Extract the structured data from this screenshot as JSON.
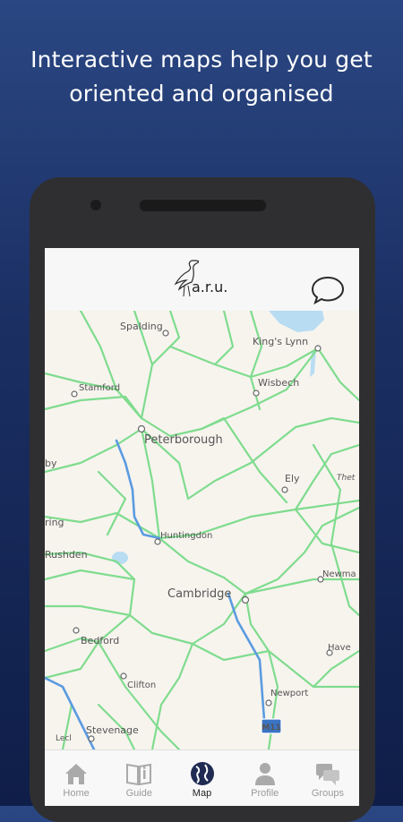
{
  "promo": {
    "headline_line1": "Interactive maps help you get",
    "headline_line2": "oriented and organised"
  },
  "app": {
    "logo_text": "a.r.u.",
    "chat_icon": "speech-bubble-icon"
  },
  "map": {
    "places": {
      "spalding": "Spalding",
      "kings_lynn": "King's Lynn",
      "stamford": "Stamford",
      "wisbech": "Wisbech",
      "peterborough": "Peterborough",
      "by": "by",
      "thetford": "Thet",
      "ely": "Ely",
      "ring": "ring",
      "huntingdon": "Huntingdon",
      "rushden": "Rushden",
      "newmarket": "Newma",
      "cambridge": "Cambridge",
      "bedford": "Bedford",
      "haverhill": "Have",
      "clifton": "Clifton",
      "newport": "Newport",
      "stevenage": "Stevenage",
      "letchworth": "Lecl",
      "m11": "M11"
    },
    "colors": {
      "land": "#f7f4ee",
      "roads": "#7fdc8e",
      "motorway": "#5b9be0",
      "water": "#b8dcf2"
    }
  },
  "tabs": [
    {
      "label": "Home",
      "icon": "home-icon"
    },
    {
      "label": "Guide",
      "icon": "book-icon"
    },
    {
      "label": "Map",
      "icon": "globe-icon"
    },
    {
      "label": "Profile",
      "icon": "person-icon"
    },
    {
      "label": "Groups",
      "icon": "chat-bubbles-icon"
    }
  ],
  "active_tab": "Map"
}
